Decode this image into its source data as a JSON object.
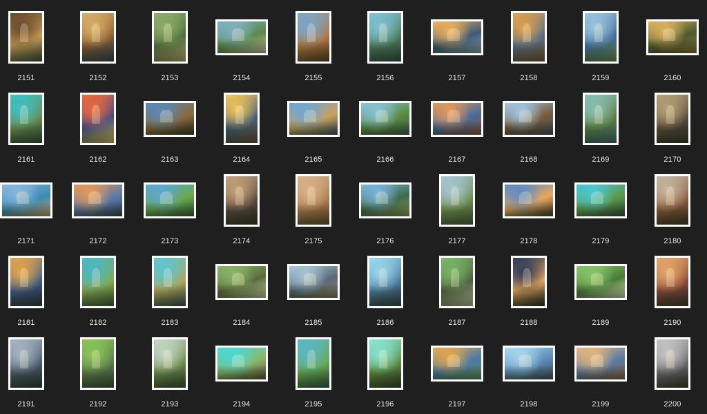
{
  "gallery": {
    "items": [
      {
        "label": "2151",
        "orientation": "portrait",
        "colors": [
          "#6b4a2e",
          "#c89a55",
          "#3b4a3a"
        ]
      },
      {
        "label": "2152",
        "orientation": "portrait",
        "colors": [
          "#d9b06a",
          "#8a5a2c",
          "#2e3f5a"
        ]
      },
      {
        "label": "2153",
        "orientation": "portrait",
        "colors": [
          "#8fb06a",
          "#4a6a3a",
          "#c8b27a"
        ]
      },
      {
        "label": "2154",
        "orientation": "landscape",
        "colors": [
          "#7fb3c9",
          "#5c8a4a",
          "#c9c2a0"
        ]
      },
      {
        "label": "2155",
        "orientation": "portrait",
        "colors": [
          "#7aa8cf",
          "#b4773f",
          "#5a3a22"
        ]
      },
      {
        "label": "2156",
        "orientation": "portrait",
        "colors": [
          "#7fc4d8",
          "#4d7a5a",
          "#2f4a46"
        ]
      },
      {
        "label": "2157",
        "orientation": "landscape",
        "colors": [
          "#f2b35a",
          "#3e5a77",
          "#8aa2b8"
        ]
      },
      {
        "label": "2158",
        "orientation": "portrait",
        "colors": [
          "#e0a24e",
          "#4f6a8a",
          "#7a5230"
        ]
      },
      {
        "label": "2159",
        "orientation": "portrait",
        "colors": [
          "#9ec7e3",
          "#3d6a95",
          "#6a8a4f"
        ]
      },
      {
        "label": "2160",
        "orientation": "landscape",
        "colors": [
          "#e3b562",
          "#4e5a2e",
          "#8a6a3a"
        ]
      },
      {
        "label": "2161",
        "orientation": "portrait",
        "colors": [
          "#3fc1c7",
          "#6a8a4a",
          "#2e4a3a"
        ]
      },
      {
        "label": "2162",
        "orientation": "portrait",
        "colors": [
          "#f06a3a",
          "#3a4a8a",
          "#e8c45a"
        ]
      },
      {
        "label": "2163",
        "orientation": "landscape",
        "colors": [
          "#5a8ab8",
          "#8a6a3e",
          "#3a2e22"
        ]
      },
      {
        "label": "2164",
        "orientation": "portrait",
        "colors": [
          "#f2c45a",
          "#3a5a7a",
          "#6a4a2e"
        ]
      },
      {
        "label": "2165",
        "orientation": "landscape",
        "colors": [
          "#6ea6d8",
          "#c9a25a",
          "#3a4a5a"
        ]
      },
      {
        "label": "2166",
        "orientation": "landscape",
        "colors": [
          "#8ac6e0",
          "#5a8a3e",
          "#3e5a4a"
        ]
      },
      {
        "label": "2167",
        "orientation": "landscape",
        "colors": [
          "#e89a5a",
          "#4a6a9a",
          "#8a4a3a"
        ]
      },
      {
        "label": "2168",
        "orientation": "landscape",
        "colors": [
          "#a2c8e8",
          "#7a5a3a",
          "#3e4a5a"
        ]
      },
      {
        "label": "2169",
        "orientation": "portrait",
        "colors": [
          "#8ac2b8",
          "#5a7a3a",
          "#3a6a7a"
        ]
      },
      {
        "label": "2170",
        "orientation": "portrait",
        "colors": [
          "#b8a27a",
          "#5a4a3a",
          "#2e2e2a"
        ]
      },
      {
        "label": "2171",
        "orientation": "landscape",
        "colors": [
          "#8ab8e0",
          "#3a8ab0",
          "#c9a06a"
        ]
      },
      {
        "label": "2172",
        "orientation": "landscape",
        "colors": [
          "#e89a5a",
          "#5a7aa8",
          "#2e3e5a"
        ]
      },
      {
        "label": "2173",
        "orientation": "landscape",
        "colors": [
          "#5aa8d8",
          "#6aa84a",
          "#2e5a3a"
        ]
      },
      {
        "label": "2174",
        "orientation": "portrait",
        "colors": [
          "#c8a27a",
          "#5a4a3e",
          "#2e2a26"
        ]
      },
      {
        "label": "2175",
        "orientation": "portrait",
        "colors": [
          "#dcb48a",
          "#a87a4e",
          "#6a4a2e"
        ]
      },
      {
        "label": "2176",
        "orientation": "landscape",
        "colors": [
          "#7ab8e0",
          "#3e6a4a",
          "#8a9a5a"
        ]
      },
      {
        "label": "2177",
        "orientation": "portrait",
        "colors": [
          "#a8c8d8",
          "#6a8a4a",
          "#4a5a3a"
        ]
      },
      {
        "label": "2178",
        "orientation": "landscape",
        "colors": [
          "#5a8ac8",
          "#e8a85a",
          "#3a2e22"
        ]
      },
      {
        "label": "2179",
        "orientation": "landscape",
        "colors": [
          "#4ac8d8",
          "#5a9a4a",
          "#2e4a3a"
        ]
      },
      {
        "label": "2180",
        "orientation": "portrait",
        "colors": [
          "#c8b8a2",
          "#8a5a3a",
          "#3a2e26"
        ]
      },
      {
        "label": "2181",
        "orientation": "portrait",
        "colors": [
          "#e8a84a",
          "#3a5a8a",
          "#2a2a3a"
        ]
      },
      {
        "label": "2182",
        "orientation": "portrait",
        "colors": [
          "#4ab8c8",
          "#8aa84a",
          "#3a5a3a"
        ]
      },
      {
        "label": "2183",
        "orientation": "portrait",
        "colors": [
          "#5ac8d8",
          "#b8a24a",
          "#2e4a5a"
        ]
      },
      {
        "label": "2184",
        "orientation": "landscape",
        "colors": [
          "#8ab86a",
          "#5a6a3a",
          "#c8d8a8"
        ]
      },
      {
        "label": "2185",
        "orientation": "landscape",
        "colors": [
          "#a8c8d8",
          "#5a6a7a",
          "#8a7a5a"
        ]
      },
      {
        "label": "2186",
        "orientation": "portrait",
        "colors": [
          "#9ad8f0",
          "#4a7a9a",
          "#2e3a4a"
        ]
      },
      {
        "label": "2187",
        "orientation": "portrait",
        "colors": [
          "#7ab86a",
          "#4a5a3a",
          "#c8c8a8"
        ]
      },
      {
        "label": "2188",
        "orientation": "portrait",
        "colors": [
          "#2e3a5a",
          "#e8a85a",
          "#1a1a22"
        ]
      },
      {
        "label": "2189",
        "orientation": "landscape",
        "colors": [
          "#8ac86a",
          "#4a7a3a",
          "#d8e8b8"
        ]
      },
      {
        "label": "2190",
        "orientation": "portrait",
        "colors": [
          "#e8a86a",
          "#8a4a3a",
          "#3a2a2a"
        ]
      },
      {
        "label": "2191",
        "orientation": "portrait",
        "colors": [
          "#a8b8c8",
          "#4a5a6a",
          "#2a2e3a"
        ]
      },
      {
        "label": "2192",
        "orientation": "portrait",
        "colors": [
          "#8ac85a",
          "#5a7a4a",
          "#3a4a3a"
        ]
      },
      {
        "label": "2193",
        "orientation": "portrait",
        "colors": [
          "#c8d8c8",
          "#6a8a4a",
          "#3a4a3a"
        ]
      },
      {
        "label": "2194",
        "orientation": "landscape",
        "colors": [
          "#4ad8d8",
          "#8ab86a",
          "#5a4a3a"
        ]
      },
      {
        "label": "2195",
        "orientation": "portrait",
        "colors": [
          "#5ab8c8",
          "#6aa84a",
          "#2e5a4a"
        ]
      },
      {
        "label": "2196",
        "orientation": "portrait",
        "colors": [
          "#8ae8d8",
          "#5a8a3a",
          "#2e3a2a"
        ]
      },
      {
        "label": "2197",
        "orientation": "landscape",
        "colors": [
          "#e8a84a",
          "#4a7aa8",
          "#5a8a4a"
        ]
      },
      {
        "label": "2198",
        "orientation": "landscape",
        "colors": [
          "#a8d8f0",
          "#5a8ab8",
          "#3a4a5a"
        ]
      },
      {
        "label": "2199",
        "orientation": "landscape",
        "colors": [
          "#e8b87a",
          "#5a7aa8",
          "#8a5a3a"
        ]
      },
      {
        "label": "2200",
        "orientation": "portrait",
        "colors": [
          "#c8c8c8",
          "#6a6a6a",
          "#2e2e2e"
        ]
      }
    ]
  }
}
